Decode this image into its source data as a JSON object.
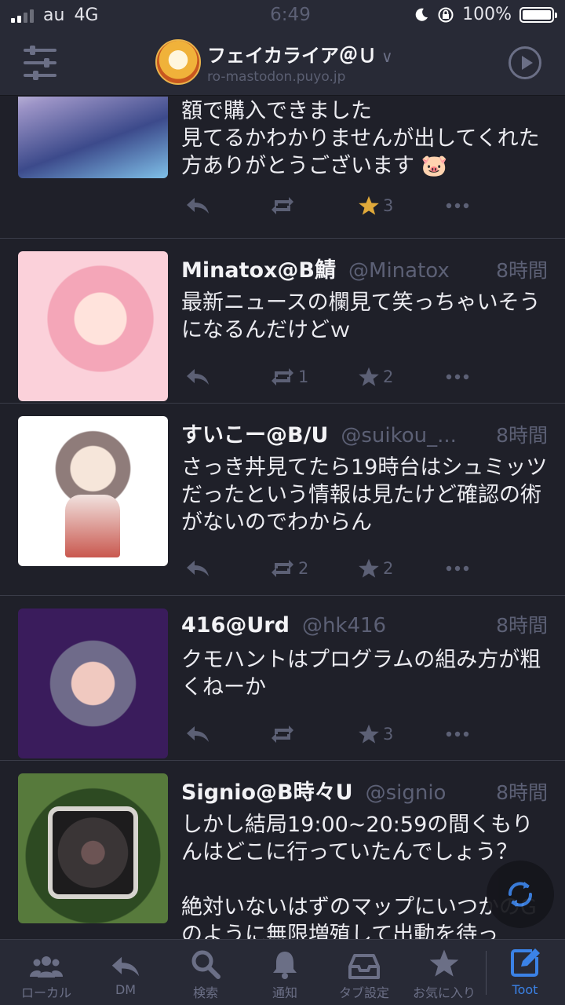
{
  "status_bar": {
    "carrier": "au",
    "network": "4G",
    "time": "6:49",
    "battery": "100%"
  },
  "header": {
    "account_name": "フェイカライア＠Ｕ",
    "account_host": "ro-mastodon.puyo.jp"
  },
  "posts": [
    {
      "name": "",
      "handle": "",
      "time": "",
      "content": "額で購入できました\n見てるかわかりませんが出してくれた方ありがとうございます 🐷",
      "reblogs": "",
      "favourites": "3",
      "favourited": true
    },
    {
      "name": "Minatox@B鯖",
      "handle": "@Minatox",
      "time": "8時間",
      "content": "最新ニュースの欄見て笑っちゃいそうになるんだけどｗ",
      "reblogs": "1",
      "favourites": "2",
      "favourited": false
    },
    {
      "name": "すいこー@B/U",
      "handle": "@suikou_...",
      "time": "8時間",
      "content": "さっき丼見てたら19時台はシュミッツだったという情報は見たけど確認の術がないのでわからん",
      "reblogs": "2",
      "favourites": "2",
      "favourited": false
    },
    {
      "name": "416@Urd",
      "handle": "@hk416",
      "time": "8時間",
      "content": "クモハントはプログラムの組み方が粗くねーか",
      "reblogs": "",
      "favourites": "3",
      "favourited": false
    },
    {
      "name": "Signio@B時々U",
      "handle": "@signio",
      "time": "8時間",
      "content": "しかし結局19:00~20:59の間くもりんはどこに行っていたんでしょう？\n\n絶対いないはずのマップにいつかのGのように無限増殖して出動を待っ",
      "reblogs": "",
      "favourites": "",
      "favourited": false
    }
  ],
  "tabs": [
    {
      "label": "ローカル",
      "icon": "people-icon"
    },
    {
      "label": "DM",
      "icon": "reply-icon"
    },
    {
      "label": "検索",
      "icon": "search-icon"
    },
    {
      "label": "通知",
      "icon": "bell-icon"
    },
    {
      "label": "タブ設定",
      "icon": "inbox-icon"
    },
    {
      "label": "お気に入り",
      "icon": "star-icon"
    },
    {
      "label": "Toot",
      "icon": "compose-icon"
    }
  ],
  "colors": {
    "background": "#1f2029",
    "bar": "#282a36",
    "muted": "#5c6075",
    "star_active": "#e0a93a",
    "accent": "#3b82e6"
  }
}
